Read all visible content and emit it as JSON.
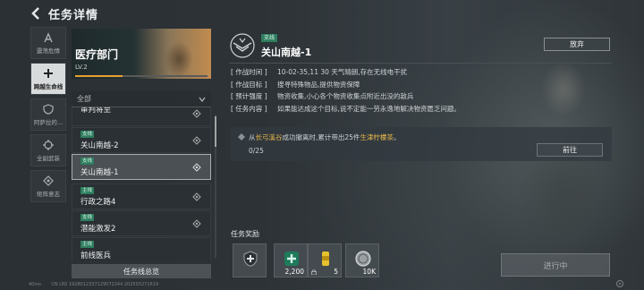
{
  "header": {
    "title": "任务详情"
  },
  "nav": [
    {
      "label": "震荡危情",
      "icon": "lambda-icon",
      "active": false
    },
    {
      "label": "跨越生命线",
      "icon": "plus-icon",
      "active": true
    },
    {
      "label": "阿萨拉的...",
      "icon": "shield-icon",
      "active": false
    },
    {
      "label": "全副武装",
      "icon": "crosshair-icon",
      "active": false
    },
    {
      "label": "矩阵意志",
      "icon": "diamond-icon",
      "active": false
    }
  ],
  "faction": {
    "name": "医疗部门",
    "level": "LV.2",
    "progress": 0.36,
    "accent": "#e8a02e"
  },
  "filter": {
    "selected": "全部"
  },
  "missions": [
    {
      "tag": "",
      "name": "审判将至",
      "selected": false,
      "cut": true
    },
    {
      "tag": "支线",
      "name": "关山南越-2",
      "selected": false,
      "cut": false
    },
    {
      "tag": "支线",
      "name": "关山南越-1",
      "selected": true,
      "cut": false
    },
    {
      "tag": "主线",
      "name": "行政之路4",
      "selected": false,
      "cut": false
    },
    {
      "tag": "支线",
      "name": "潜能激发2",
      "selected": false,
      "cut": false
    },
    {
      "tag": "主线",
      "name": "前线医兵",
      "selected": false,
      "cut": false
    }
  ],
  "overview_label": "任务线总览",
  "detail": {
    "tag": "支线",
    "title": "关山南越-1",
    "abandon_label": "放弃",
    "info": [
      {
        "key": "[ 作战时间 ]",
        "value": "10-02-35,11  30 天气晴朗,存在无线电干扰"
      },
      {
        "key": "[ 作战目标 ]",
        "value": "搜寻特殊物品,提供物资保障"
      },
      {
        "key": "[ 预计强度 ]",
        "value": "物资收集,小心各个物资收集点附近出没的敌兵"
      },
      {
        "key": "[ 任务内容 ]",
        "value": "如果能达成这个目标,说不定能一劳永逸地解决物资匮乏问题。"
      }
    ],
    "objective": {
      "prefix": "从",
      "place": "长弓溪谷",
      "middle": "成功撤离时,累计带出25件",
      "item": "生津柠檬茶",
      "suffix": "。",
      "progress": "0/25",
      "goto_label": "前往"
    },
    "reward_title": "任务奖励",
    "rewards": [
      {
        "icon": "medic-cross-icon",
        "qty": ""
      },
      {
        "icon": "medical-badge-icon",
        "qty": "2,200"
      },
      {
        "icon": "canned-drink-icon",
        "qty": "5"
      },
      {
        "icon": "coin-icon",
        "qty": "10K"
      }
    ],
    "status_label": "进行中"
  },
  "footer": {
    "ping": "40ms",
    "uid": "CN UID 1928012337129072244 202503271619"
  },
  "colors": {
    "tag_green": "#2e7d5e",
    "highlight": "#e8b84a"
  }
}
